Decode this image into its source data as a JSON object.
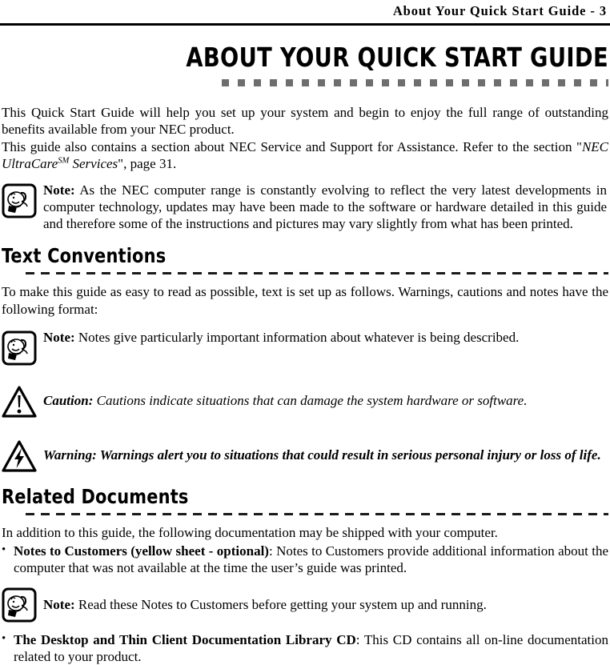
{
  "header": {
    "running_title": "About Your Quick Start Guide - 3"
  },
  "chapter": {
    "title": "ABOUT YOUR QUICK START GUIDE"
  },
  "intro": {
    "paragraph_1": "This Quick Start Guide will help you set up your system and begin to enjoy the full range of outstanding benefits available from your NEC product.",
    "paragraph_2_part1": "This guide also contains a section about NEC Service and Support for Assistance. Refer to the section ",
    "paragraph_2_quote_open": "\"",
    "paragraph_2_italic": "NEC UltraCare",
    "paragraph_2_sup": "SM",
    "paragraph_2_italic_2": " Services",
    "paragraph_2_quote_close": "\"",
    "paragraph_2_part2": ", page 31."
  },
  "note_1": {
    "icon": "note-hand-pen-icon",
    "lead": "Note:",
    "text": " As the NEC computer range is constantly evolving to reflect the very latest developments in computer technology, updates may have been made to the software or hardware detailed in this guide and therefore some of the instructions and pictures may vary slightly from what has been printed."
  },
  "section_text_conventions": {
    "heading": "Text Conventions",
    "intro": "To make this guide as easy to read as possible, text is set up as follows. Warnings, cautions and notes have the following format:"
  },
  "note_2": {
    "icon": "note-hand-pen-icon",
    "lead": "Note:",
    "text": " Notes give particularly important information about whatever is being described."
  },
  "caution": {
    "icon": "caution-triangle-exclamation-icon",
    "lead": "Caution:",
    "text": "  Cautions indicate situations that can damage the system hardware or software."
  },
  "warning": {
    "icon": "warning-triangle-lightning-icon",
    "lead": "Warning:",
    "text": " Warnings alert you to situations that could result in serious personal injury or loss of life."
  },
  "section_related_documents": {
    "heading": "Related Documents",
    "intro": "In addition to this guide, the following documentation may be shipped with your computer.",
    "bullets": [
      {
        "marker": "•",
        "bold": "Notes to Customers (yellow sheet - optional)",
        "rest": ": Notes to Customers provide additional information about the computer that was not available at the time the user’s guide was printed."
      },
      {
        "marker": "•",
        "bold": "The Desktop and Thin Client Documentation Library CD",
        "rest": ": This CD contains all on-line documentation related to your product."
      }
    ]
  },
  "note_3": {
    "icon": "note-hand-pen-icon",
    "lead": "Note:",
    "text": "  Read these Notes to Customers before getting your system up and running."
  },
  "colors": {
    "text": "#000000",
    "title_dots": "#6e6e6e",
    "rule": "#000000",
    "page_background": "#ffffff"
  }
}
